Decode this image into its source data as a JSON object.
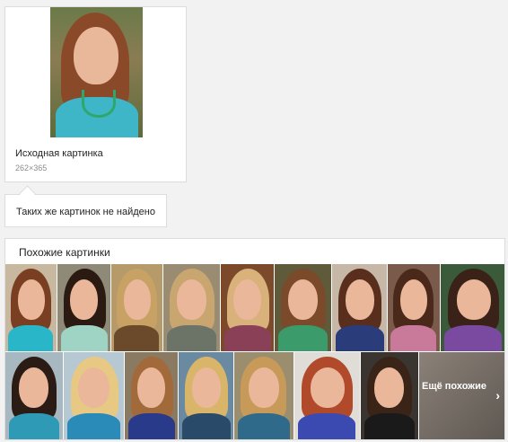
{
  "source": {
    "caption": "Исходная картинка",
    "size": "262×365"
  },
  "not_found": {
    "text": "Таких же картинок не найдено"
  },
  "similar": {
    "title": "Похожие картинки",
    "more_label": "Ещё похожие",
    "more_icon": "chevron-right-icon",
    "row1_count": 9,
    "row2_count": 7
  }
}
